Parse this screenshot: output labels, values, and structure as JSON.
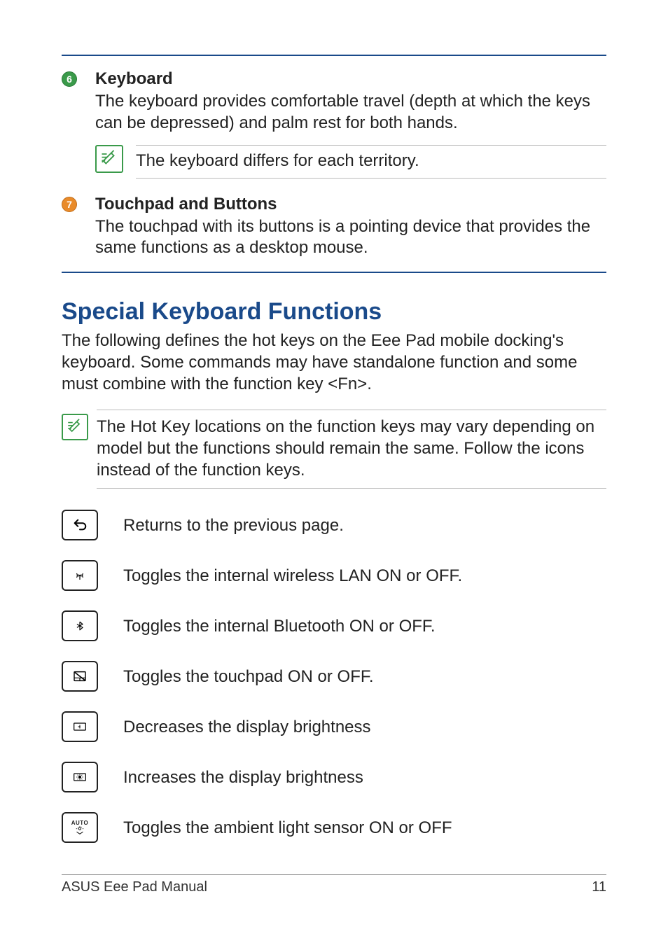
{
  "items": [
    {
      "number": "6",
      "title": "Keyboard",
      "desc": "The keyboard provides comfortable travel (depth at which the keys can be depressed) and palm rest for both hands.",
      "note": "The keyboard differs for each territory."
    },
    {
      "number": "7",
      "title": "Touchpad and Buttons",
      "desc": "The touchpad with its buttons is a pointing device that provides the same functions as a desktop mouse."
    }
  ],
  "section": {
    "title": "Special Keyboard Functions",
    "intro": "The following defines the hot keys on the Eee Pad mobile docking's keyboard. Some commands may have standalone function and some must combine with the function key <Fn>.",
    "note": "The Hot Key locations on the function keys may vary depending on model but the functions should remain the same. Follow the icons instead of the function keys."
  },
  "keys": [
    {
      "icon": "back",
      "desc": "Returns to the previous page."
    },
    {
      "icon": "wifi",
      "desc": "Toggles the internal wireless LAN ON or OFF."
    },
    {
      "icon": "bluetooth",
      "desc": "Toggles the internal Bluetooth ON or OFF."
    },
    {
      "icon": "touchpad",
      "desc": "Toggles the touchpad ON or OFF."
    },
    {
      "icon": "brightness-down",
      "desc": "Decreases the display brightness"
    },
    {
      "icon": "brightness-up",
      "desc": "Increases the display brightness"
    },
    {
      "icon": "auto-light",
      "desc": "Toggles the ambient light sensor ON or OFF"
    }
  ],
  "footer": {
    "left": "ASUS Eee Pad Manual",
    "right": "11"
  }
}
